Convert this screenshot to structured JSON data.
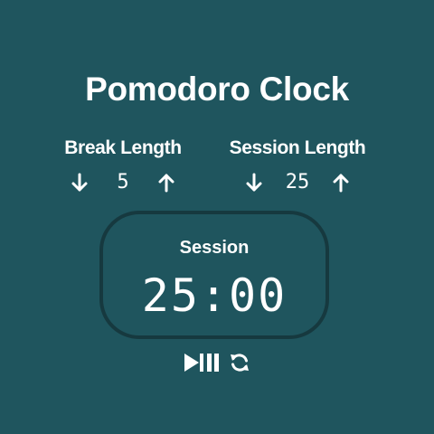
{
  "title": "Pomodoro Clock",
  "break": {
    "label": "Break Length",
    "value": "5",
    "decrement_icon": "arrow-down-icon",
    "increment_icon": "arrow-up-icon"
  },
  "session": {
    "label": "Session Length",
    "value": "25",
    "decrement_icon": "arrow-down-icon",
    "increment_icon": "arrow-up-icon"
  },
  "timer": {
    "label": "Session",
    "time_left": "25:00"
  },
  "controls": {
    "start_stop_icon": "play-pause-icon",
    "reset_icon": "refresh-icon"
  },
  "colors": {
    "background": "#1f555e",
    "timer_border": "#16393f",
    "text": "#ffffff"
  }
}
